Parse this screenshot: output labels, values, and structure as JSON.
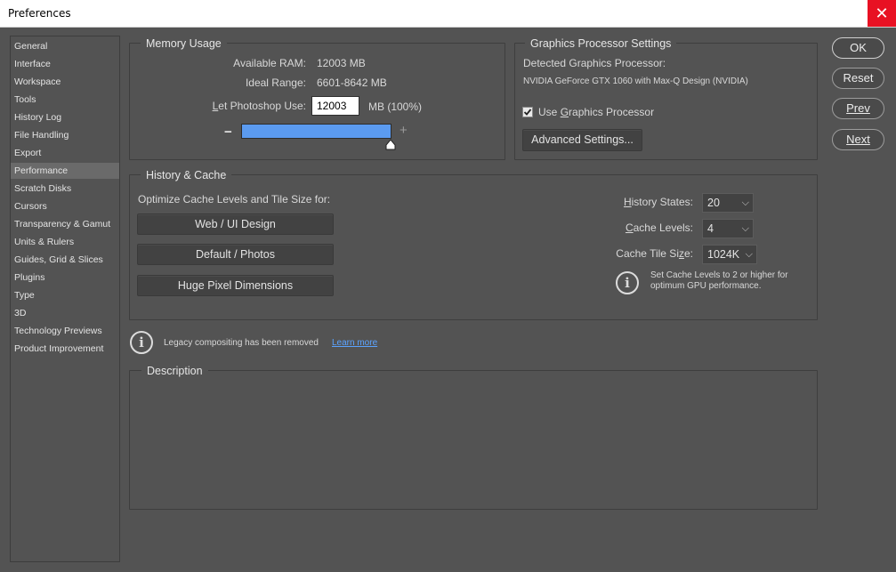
{
  "window": {
    "title": "Preferences",
    "close": "✕"
  },
  "sidebar": {
    "items": [
      {
        "label": "General"
      },
      {
        "label": "Interface"
      },
      {
        "label": "Workspace"
      },
      {
        "label": "Tools"
      },
      {
        "label": "History Log"
      },
      {
        "label": "File Handling"
      },
      {
        "label": "Export"
      },
      {
        "label": "Performance",
        "active": true
      },
      {
        "label": "Scratch Disks"
      },
      {
        "label": "Cursors"
      },
      {
        "label": "Transparency & Gamut"
      },
      {
        "label": "Units & Rulers"
      },
      {
        "label": "Guides, Grid & Slices"
      },
      {
        "label": "Plugins"
      },
      {
        "label": "Type"
      },
      {
        "label": "3D"
      },
      {
        "label": "Technology Previews"
      },
      {
        "label": "Product Improvement"
      }
    ]
  },
  "memory": {
    "title": "Memory Usage",
    "available_label": "Available RAM:",
    "available_value": "12003 MB",
    "ideal_label": "Ideal Range:",
    "ideal_value": "6601-8642 MB",
    "let_label": "Let Photoshop Use:",
    "let_value": "12003",
    "let_unit": "MB (100%)",
    "slider_fraction": 1.0,
    "minus": "−",
    "plus": "+"
  },
  "gpu": {
    "title": "Graphics Processor Settings",
    "detected_label": "Detected Graphics Processor:",
    "detected_value": "NVIDIA GeForce GTX 1060 with Max-Q Design (NVIDIA)",
    "use_label": "Use Graphics Processor",
    "use_checked": true,
    "advanced_button": "Advanced Settings..."
  },
  "history_cache": {
    "title": "History & Cache",
    "optimize_label": "Optimize Cache Levels and Tile Size for:",
    "btn_web": "Web / UI Design",
    "btn_default": "Default / Photos",
    "btn_huge": "Huge Pixel Dimensions",
    "history_states_label": "History States:",
    "history_states_value": "20",
    "cache_levels_label": "Cache Levels:",
    "cache_levels_value": "4",
    "cache_tile_label": "Cache Tile Size:",
    "cache_tile_value": "1024K",
    "info_line1": "Set Cache Levels to 2 or higher for",
    "info_line2": "optimum GPU performance."
  },
  "legacy": {
    "text": "Legacy compositing has been removed",
    "link": "Learn more"
  },
  "description": {
    "title": "Description"
  },
  "buttons": {
    "ok": "OK",
    "reset": "Reset",
    "prev": "Prev",
    "next": "Next"
  },
  "colors": {
    "slider": "#5b9bf0",
    "link": "#5ba3ff",
    "close_bg": "#e81123"
  }
}
